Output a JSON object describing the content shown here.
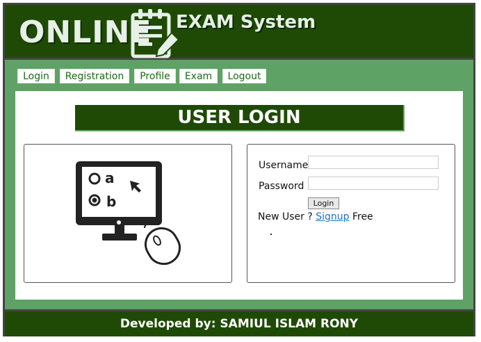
{
  "header": {
    "logo_left": "ONLINE",
    "logo_right": "EXAM System",
    "notepad_icon": "notepad-pencil-icon"
  },
  "nav": {
    "items": [
      {
        "label": "Login"
      },
      {
        "label": "Registration"
      },
      {
        "label": "Profile"
      },
      {
        "label": "Exam"
      },
      {
        "label": "Logout"
      }
    ]
  },
  "main": {
    "title": "USER LOGIN",
    "illustration": {
      "icon": "computer-quiz-icon",
      "option_a": "a",
      "option_b": "b"
    },
    "form": {
      "username_label": "Username",
      "username_value": "",
      "password_label": "Password",
      "password_value": "",
      "login_button": "Login",
      "new_user_text": "New User ?",
      "signup_link": "Signup",
      "free_text": "Free"
    }
  },
  "footer": {
    "credit": "Developed by: SAMIUL ISLAM RONY"
  },
  "colors": {
    "header_green": "#1f4a05",
    "body_green": "#5fa266",
    "nav_text": "#1a6b14",
    "link_blue": "#1a73c8"
  }
}
